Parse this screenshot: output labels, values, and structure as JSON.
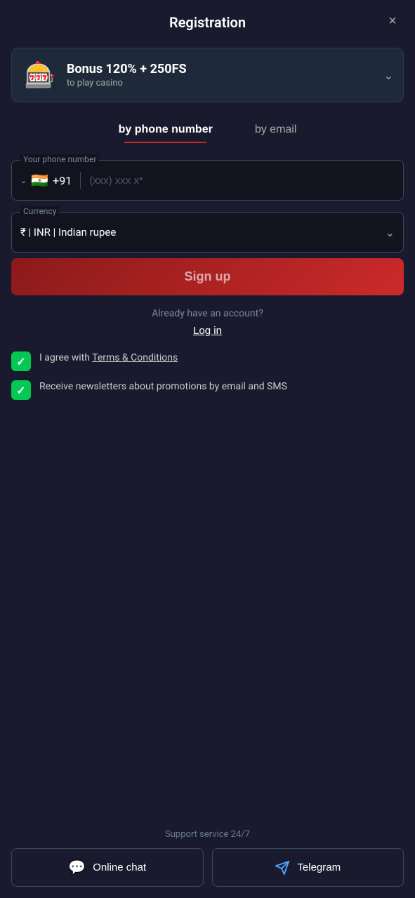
{
  "header": {
    "title": "Registration",
    "close_label": "×"
  },
  "bonus": {
    "icon": "🎰",
    "title": "Bonus 120% + 250FS",
    "subtitle": "to play casino",
    "chevron": "∨"
  },
  "tabs": [
    {
      "id": "phone",
      "label": "by phone number",
      "active": true
    },
    {
      "id": "email",
      "label": "by email",
      "active": false
    }
  ],
  "form": {
    "phone": {
      "label": "Your phone number",
      "country_flag": "🇮🇳",
      "country_code": "+91",
      "placeholder": "(xxx) xxx x*"
    },
    "currency": {
      "label": "Currency",
      "value": "₹  |  INR  |  Indian rupee"
    }
  },
  "signup_button": "Sign up",
  "login": {
    "prompt": "Already have an account?",
    "link": "Log in"
  },
  "checkboxes": [
    {
      "id": "terms",
      "checked": true,
      "label_prefix": "I agree with ",
      "link_text": "Terms & Conditions",
      "label_suffix": ""
    },
    {
      "id": "newsletter",
      "checked": true,
      "label": "Receive newsletters about promotions by email and SMS"
    }
  ],
  "support": {
    "label": "Support service 24/7",
    "online_chat": "Online chat",
    "telegram": "Telegram"
  }
}
